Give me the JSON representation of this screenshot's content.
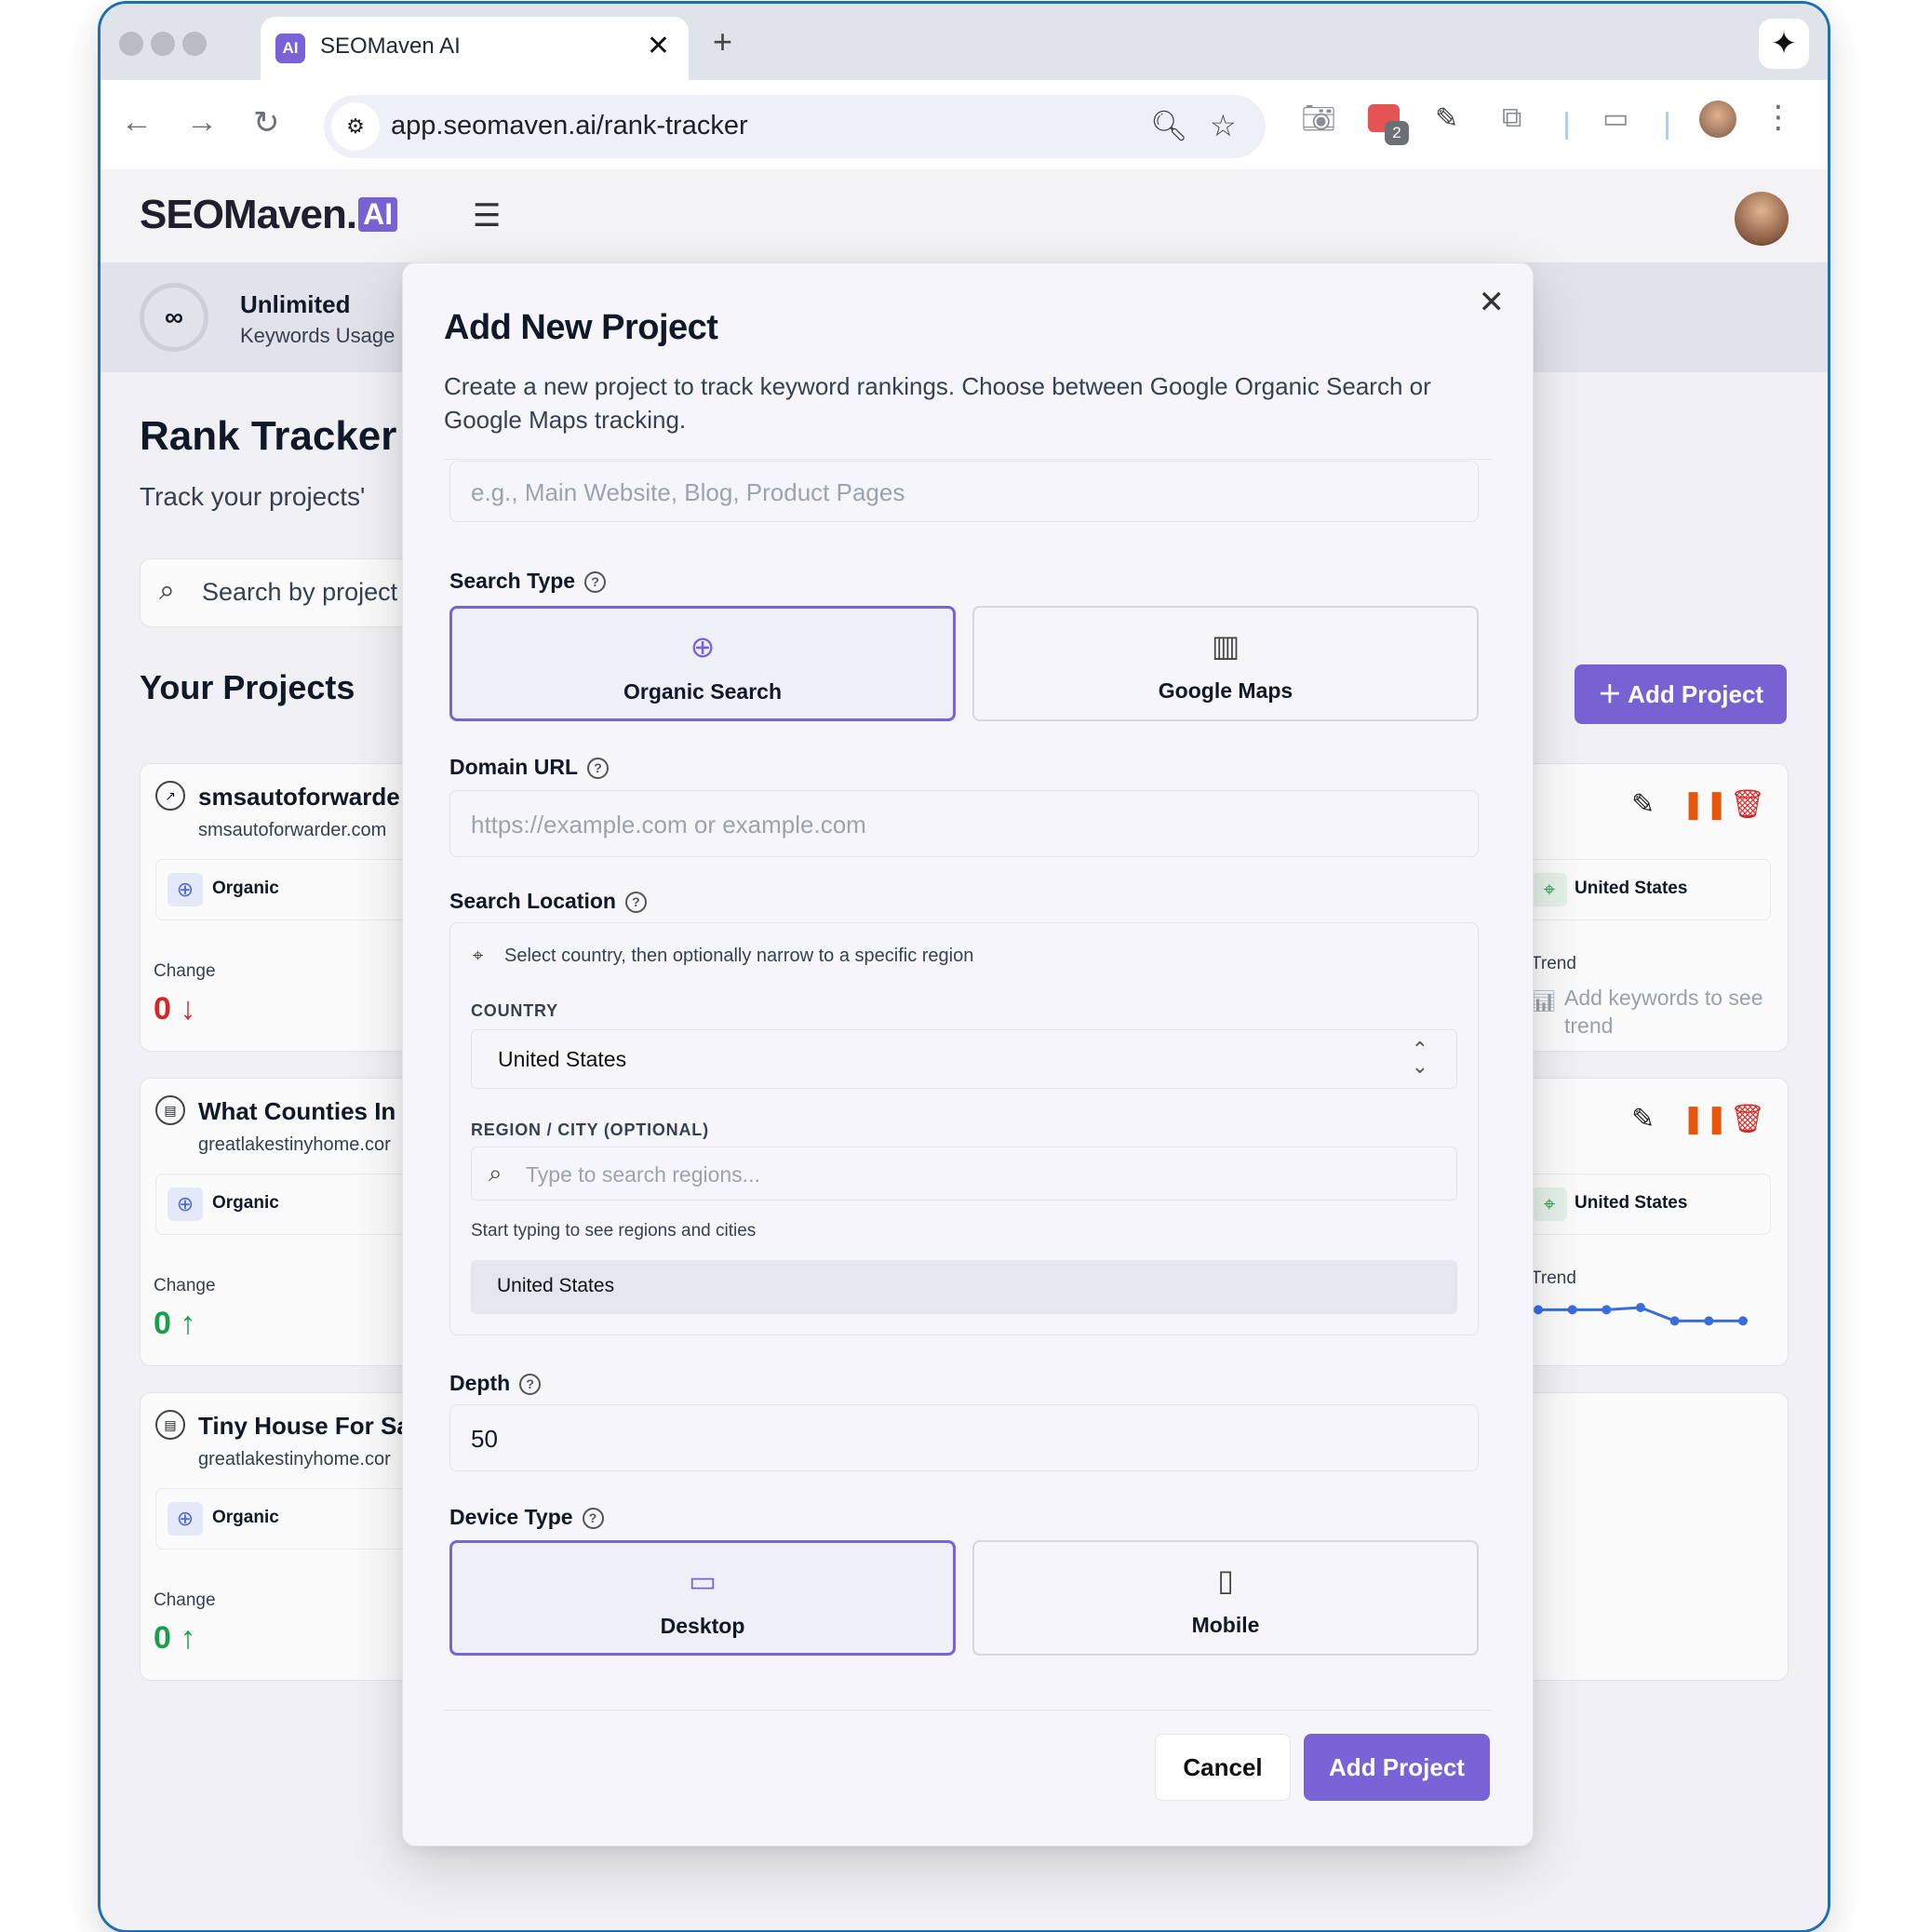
{
  "browser": {
    "tab_title": "SEOMaven AI",
    "tab_logo": "AI",
    "url": "app.seomaven.ai/rank-tracker",
    "extension_badge": "2"
  },
  "app": {
    "brand": "SEOMaven.",
    "brand_ai": "AI",
    "usage_value": "∞",
    "usage_title": "Unlimited",
    "usage_sub": "Keywords Usage",
    "page_title": "Rank Tracker",
    "page_sub": "Track your projects'",
    "search_placeholder": "Search by project",
    "section_title": "Your Projects",
    "add_project_button": "Add Project"
  },
  "projects": [
    {
      "name": "smsautoforwarde",
      "domain": "smsautoforwarder.com",
      "type": "Organic",
      "change_label": "Change",
      "change_value": "0",
      "change_dir": "down",
      "change_color": "#dc2626",
      "location": "United States",
      "trend_label": "Trend",
      "trend_empty": "Add keywords to see trend"
    },
    {
      "name": "What Counties In",
      "domain": "greatlakestinyhome.cor",
      "type": "Organic",
      "change_label": "Change",
      "change_value": "0",
      "change_dir": "up",
      "change_color": "#16a34a",
      "location": "United States",
      "trend_label": "Trend",
      "trend_points": [
        1,
        1,
        1,
        0.8,
        2,
        2,
        2
      ]
    },
    {
      "name": "Tiny House For Sa",
      "domain": "greatlakestinyhome.cor",
      "type": "Organic",
      "change_label": "Change",
      "change_value": "0",
      "change_dir": "up",
      "change_color": "#16a34a"
    }
  ],
  "modal": {
    "title": "Add New Project",
    "description": "Create a new project to track keyword rankings. Choose between Google Organic Search or Google Maps tracking.",
    "name_placeholder": "e.g., Main Website, Blog, Product Pages",
    "search_type_label": "Search Type",
    "search_type_options": [
      {
        "label": "Organic Search",
        "icon": "globe-icon",
        "selected": true
      },
      {
        "label": "Google Maps",
        "icon": "building-icon",
        "selected": false
      }
    ],
    "domain_label": "Domain URL",
    "domain_placeholder": "https://example.com or example.com",
    "location_label": "Search Location",
    "location_hint": "Select country, then optionally narrow to a specific region",
    "country_caption": "COUNTRY",
    "country_value": "United States",
    "region_caption": "REGION / CITY (OPTIONAL)",
    "region_placeholder": "Type to search regions...",
    "region_hint": "Start typing to see regions and cities",
    "selected_location": "United States",
    "depth_label": "Depth",
    "depth_value": "50",
    "device_label": "Device Type",
    "device_options": [
      {
        "label": "Desktop",
        "icon": "monitor-icon",
        "selected": true
      },
      {
        "label": "Mobile",
        "icon": "phone-icon",
        "selected": false
      }
    ],
    "cancel_label": "Cancel",
    "submit_label": "Add Project"
  },
  "colors": {
    "accent": "#7a63d6",
    "danger": "#dc2626",
    "success": "#16a34a",
    "pause": "#ea580c",
    "trend_line": "#3b6fe0"
  }
}
